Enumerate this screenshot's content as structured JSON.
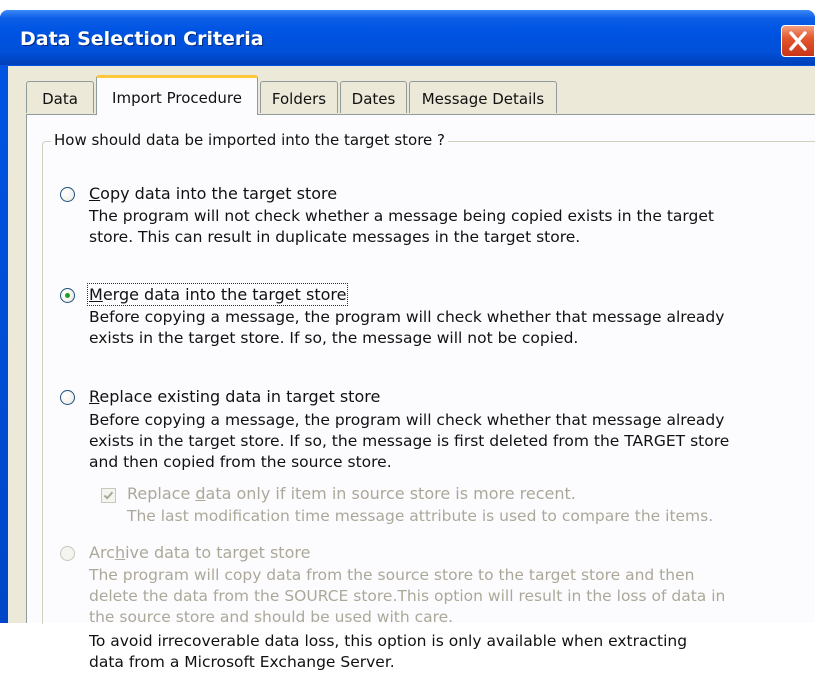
{
  "window": {
    "title": "Data Selection Criteria"
  },
  "tabs": [
    {
      "label": "Data",
      "active": false
    },
    {
      "label": "Import Procedure",
      "active": true
    },
    {
      "label": "Folders",
      "active": false
    },
    {
      "label": "Dates",
      "active": false
    },
    {
      "label": "Message Details",
      "active": false
    }
  ],
  "group": {
    "label": "How should data be imported into the target store ?"
  },
  "options": {
    "copy": {
      "label_mnemonic": "C",
      "label_rest": "opy data into the target store",
      "checked": false,
      "enabled": true,
      "description": [
        "The program will not check whether a message being copied exists in the target",
        "store. This can result in duplicate messages in the target store."
      ]
    },
    "merge": {
      "label_mnemonic": "M",
      "label_rest": "erge data into the target store",
      "checked": true,
      "enabled": true,
      "description": [
        "Before copying a message, the program will check whether that message already",
        "exists in the target store. If so, the message will not be copied."
      ]
    },
    "replace": {
      "label_mnemonic": "R",
      "label_rest": "eplace existing data in target store",
      "checked": false,
      "enabled": true,
      "description": [
        "Before copying a message, the program will check whether that message already",
        "exists in the target store. If so, the message is first deleted from the TARGET store",
        "and then copied from the source store."
      ],
      "sub_option": {
        "label_before": "Replace ",
        "label_mnemonic": "d",
        "label_after": "ata only if item in source store is more recent.",
        "description": "The last modification time message attribute is used to compare the items.",
        "checked": true,
        "enabled": false
      }
    },
    "archive": {
      "label_before": "Arc",
      "label_mnemonic": "h",
      "label_after": "ive data to target store",
      "checked": false,
      "enabled": false,
      "description": [
        "The program will copy data from the source store to the target store and then",
        "delete the data from the SOURCE store.This option will result in the loss of data in",
        "the source store and should be used with care."
      ],
      "note": [
        "To avoid irrecoverable data loss, this option is only available when extracting",
        "data from a Microsoft Exchange Server."
      ]
    }
  },
  "colors": {
    "titlebar": "#0054e3",
    "dialog_face": "#ece9d8",
    "tab_panel": "#fcfcfe",
    "disabled_text": "#aca899",
    "radio_dot": "#21a121",
    "close_button": "#e4572e"
  },
  "icons": {
    "close": "close-x-icon",
    "radio": "radio-button",
    "checkbox_tick": "checkmark-icon"
  }
}
